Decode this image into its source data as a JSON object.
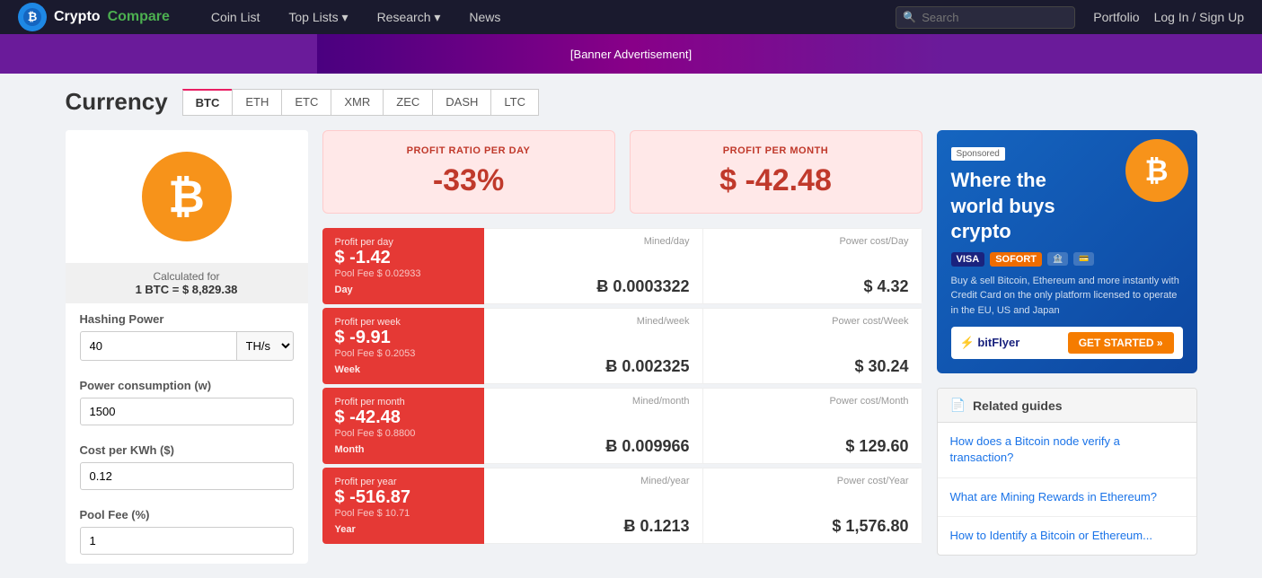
{
  "brand": {
    "logo_char": "₿",
    "text_crypto": "Crypto",
    "text_compare": "Compare"
  },
  "navbar": {
    "links": [
      {
        "id": "coin-list",
        "label": "Coin List",
        "has_arrow": false
      },
      {
        "id": "top-lists",
        "label": "Top Lists",
        "has_arrow": true
      },
      {
        "id": "research",
        "label": "Research",
        "has_arrow": true
      },
      {
        "id": "news",
        "label": "News",
        "has_arrow": false
      }
    ],
    "search_placeholder": "Search",
    "portfolio": "Portfolio",
    "login": "Log In / Sign Up"
  },
  "page": {
    "title": "Currency"
  },
  "currency_tabs": [
    "BTC",
    "ETH",
    "ETC",
    "XMR",
    "ZEC",
    "DASH",
    "LTC"
  ],
  "active_tab": "BTC",
  "left_panel": {
    "btc_symbol": "₿",
    "calculated_for_label": "Calculated for",
    "calculated_for_value": "1 BTC = $ 8,829.38",
    "hashing_power_label": "Hashing Power",
    "hashing_power_value": "40",
    "hashing_power_unit": "TH/s",
    "power_consumption_label": "Power consumption (w)",
    "power_consumption_value": "1500",
    "cost_per_kwh_label": "Cost per KWh ($)",
    "cost_per_kwh_value": "0.12",
    "pool_fee_label": "Pool Fee (%)",
    "pool_fee_value": "1"
  },
  "summary": {
    "profit_ratio_label": "PROFIT RATIO PER DAY",
    "profit_ratio_value": "-33%",
    "profit_month_label": "PROFIT PER MONTH",
    "profit_month_value": "$ -42.48"
  },
  "rows": [
    {
      "id": "day",
      "period_label": "Day",
      "profit_label": "Profit per day",
      "profit_value": "$ -1.42",
      "pool_fee": "Pool Fee $ 0.02933",
      "mined_label": "Mined/day",
      "mined_value": "Ƀ 0.0003322",
      "power_label": "Power cost/Day",
      "power_value": "$ 4.32"
    },
    {
      "id": "week",
      "period_label": "Week",
      "profit_label": "Profit per week",
      "profit_value": "$ -9.91",
      "pool_fee": "Pool Fee $ 0.2053",
      "mined_label": "Mined/week",
      "mined_value": "Ƀ 0.002325",
      "power_label": "Power cost/Week",
      "power_value": "$ 30.24"
    },
    {
      "id": "month",
      "period_label": "Month",
      "profit_label": "Profit per month",
      "profit_value": "$ -42.48",
      "pool_fee": "Pool Fee $ 0.8800",
      "mined_label": "Mined/month",
      "mined_value": "Ƀ 0.009966",
      "power_label": "Power cost/Month",
      "power_value": "$ 129.60"
    },
    {
      "id": "year",
      "period_label": "Year",
      "profit_label": "Profit per year",
      "profit_value": "$ -516.87",
      "pool_fee": "Pool Fee $ 10.71",
      "mined_label": "Mined/year",
      "mined_value": "Ƀ 0.1213",
      "power_label": "Power cost/Year",
      "power_value": "$ 1,576.80"
    }
  ],
  "ad": {
    "sponsored": "Sponsored",
    "title": "Where the world buys crypto",
    "desc": "Buy & sell Bitcoin, Ethereum and more instantly with Credit Card on the only platform licensed to operate in the EU, US and Japan",
    "get_started": "GET STARTED »",
    "bitflyer": "bitFlyer"
  },
  "related_guides": {
    "header": "Related guides",
    "items": [
      "How does a Bitcoin node verify a transaction?",
      "What are Mining Rewards in Ethereum?",
      "How to Identify a Bitcoin or Ethereum..."
    ]
  }
}
